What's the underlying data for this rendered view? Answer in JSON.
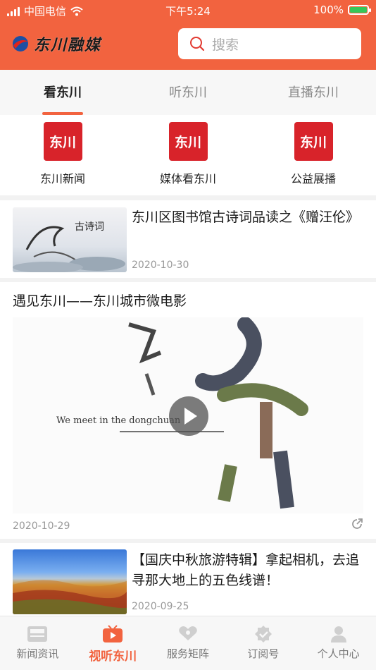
{
  "status": {
    "carrier": "中国电信",
    "time": "下午5:24",
    "battery": "100%"
  },
  "header": {
    "logo_text": "东川融媒",
    "search_placeholder": "搜索"
  },
  "tabs": [
    {
      "label": "看东川",
      "active": true
    },
    {
      "label": "听东川",
      "active": false
    },
    {
      "label": "直播东川",
      "active": false
    }
  ],
  "quick": [
    {
      "icon_text": "东川",
      "label": "东川新闻"
    },
    {
      "icon_text": "东川",
      "label": "媒体看东川"
    },
    {
      "icon_text": "东川",
      "label": "公益展播"
    }
  ],
  "feed": {
    "item1": {
      "title": "东川区图书馆古诗词品读之《赠汪伦》",
      "date": "2020-10-30",
      "thumb_text": "古诗词"
    },
    "video": {
      "title": "遇见东川——东川城市微电影",
      "date": "2020-10-29",
      "overlay_text": "We meet in the dongchuan"
    },
    "item3": {
      "title": "【国庆中秋旅游特辑】拿起相机，去追寻那大地上的五色线谱！",
      "date": "2020-09-25"
    }
  },
  "nav": [
    {
      "label": "新闻资讯",
      "icon": "news-icon",
      "active": false
    },
    {
      "label": "视听东川",
      "icon": "video-icon",
      "active": true
    },
    {
      "label": "服务矩阵",
      "icon": "service-icon",
      "active": false
    },
    {
      "label": "订阅号",
      "icon": "subscribe-icon",
      "active": false
    },
    {
      "label": "个人中心",
      "icon": "user-icon",
      "active": false
    }
  ],
  "colors": {
    "brand": "#f2633f",
    "icon_red": "#d8232a"
  }
}
